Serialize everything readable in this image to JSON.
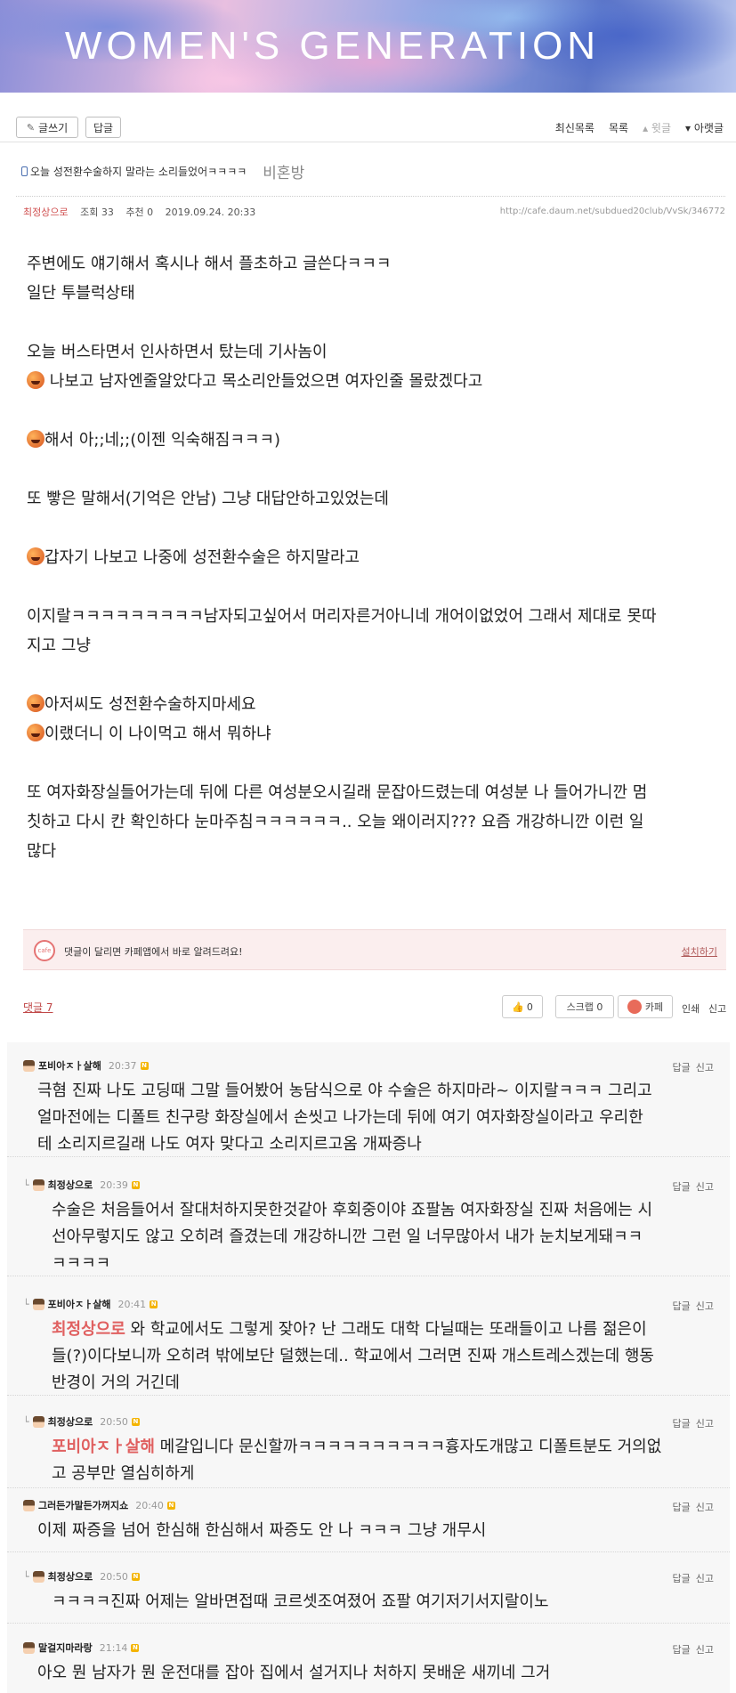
{
  "banner": {
    "title": "WOMEN'S GENERATION"
  },
  "toolbar": {
    "write_label": "글쓰기",
    "reply_label": "답글",
    "nav": [
      "최신목록",
      "목록",
      "윗글",
      "아랫글"
    ]
  },
  "post": {
    "title": "오늘 성전환수술하지 말라는 소리들었어ㅋㅋㅋㅋ",
    "board": "비혼방",
    "author": "최정상으로",
    "views": "조회 33",
    "recommend": "추천 0",
    "date": "2019.09.24. 20:33",
    "url": "http://cafe.daum.net/subdued20club/VvSk/346772",
    "lines": [
      "주변에도 얘기해서 혹시나 해서 플초하고 글쓴다ㅋㅋㅋ",
      "일단 투블럭상태",
      "",
      "오늘 버스타면서 인사하면서 탔는데 기사놈이",
      " 나보고 남자엔줄알았다고 목소리안들었으면 여자인줄 몰랐겠다고",
      "",
      "해서 아;;네;;(이젠 익숙해짐ㅋㅋㅋ)",
      "",
      "또 빻은 말해서(기억은 안남) 그냥 대답안하고있었는데",
      "",
      "갑자기 나보고 나중에 성전환수술은 하지말라고",
      "",
      "이지랄ㅋㅋㅋㅋㅋㅋㅋㅋㅋ남자되고싶어서 머리자른거아니네 개어이없었어 그래서 제대로 못따",
      "지고 그냥",
      "",
      "아저씨도 성전환수술하지마세요",
      "이랬더니 이 나이먹고 해서 뭐하냐",
      "",
      "또 여자화장실들어가는데 뒤에 다른 여성분오시길래 문잡아드렸는데 여성분 나 들어가니깐 멈",
      "칫하고 다시 칸 확인하다 눈마주침ㅋㅋㅋㅋㅋㅋ.. 오늘 왜이러지??? 요즘 개강하니깐 이런 일",
      "많다"
    ]
  },
  "notice": {
    "logo": "cafe",
    "text": "댓글이 달리면 카페앱에서 바로 알려드려요!",
    "link": "설치하기"
  },
  "comment_bar": {
    "count_label": "댓글 7",
    "like_count": "0",
    "scrap_label": "스크랩 0",
    "cafe_label": "카페",
    "print_label": "인쇄",
    "report_label": "신고"
  },
  "comment_actions": {
    "reply": "답글",
    "report": "신고"
  },
  "comments": [
    {
      "author": "포비아ㅈㅏ살해",
      "time": "20:37",
      "mention": "",
      "lines": [
        "극혐 진짜 나도 고딩때 그말 들어봤어 농담식으로 야 수술은 하지마라~ 이지랄ㅋㅋㅋ 그리고",
        "얼마전에는 디폴트 친구랑 화장실에서 손씻고 나가는데 뒤에 여기 여자화장실이라고 우리한",
        "테 소리지르길래 나도 여자 맞다고 소리지르고옴 개짜증나"
      ]
    },
    {
      "author": "최정상으로",
      "time": "20:39",
      "mention": "",
      "lines": [
        "수술은 처음들어서 잘대처하지못한것같아 후회중이야 죠팔놈 여자화장실 진짜 처음에는 시",
        "선아무렇지도 않고 오히려 즐겼는데 개강하니깐 그런 일 너무많아서 내가 눈치보게돼ㅋㅋ",
        "ㅋㅋㅋㅋ"
      ]
    },
    {
      "author": "포비아ㅈㅏ살해",
      "time": "20:41",
      "mention": "최정상으로",
      "lines": [
        " 와 학교에서도 그렇게 잦아? 난 그래도 대학 다닐때는 또래들이고 나름 젊은이",
        "들(?)이다보니까 오히려 밖에보단 덜했는데.. 학교에서 그러면 진짜 개스트레스겠는데 행동",
        "반경이 거의 거긴데"
      ]
    },
    {
      "author": "최정상으로",
      "time": "20:50",
      "mention": "포비아ㅈㅏ살해",
      "lines": [
        " 메갈입니다 문신할까ㅋㅋㅋㅋㅋㅋㅋㅋㅋㅋ흉자도개많고 디폴트분도 거의없",
        "고 공부만 열심히하게"
      ]
    },
    {
      "author": "그러든가말든가꺼지쇼",
      "time": "20:40",
      "mention": "",
      "lines": [
        "이제 짜증을 넘어 한심해 한심해서 짜증도 안 나 ㅋㅋㅋ 그냥 개무시"
      ]
    },
    {
      "author": "최정상으로",
      "time": "20:50",
      "mention": "",
      "lines": [
        "ㅋㅋㅋㅋ진짜 어제는 알바면접때 코르셋조여졌어 죠팔 여기저기서지랄이노"
      ]
    },
    {
      "author": "말걸지마라랑",
      "time": "21:14",
      "mention": "",
      "lines": [
        "아오 뭔 남자가 뭔 운전대를 잡아 집에서 설거지나 처하지 못배운 새끼네 그거"
      ]
    }
  ]
}
